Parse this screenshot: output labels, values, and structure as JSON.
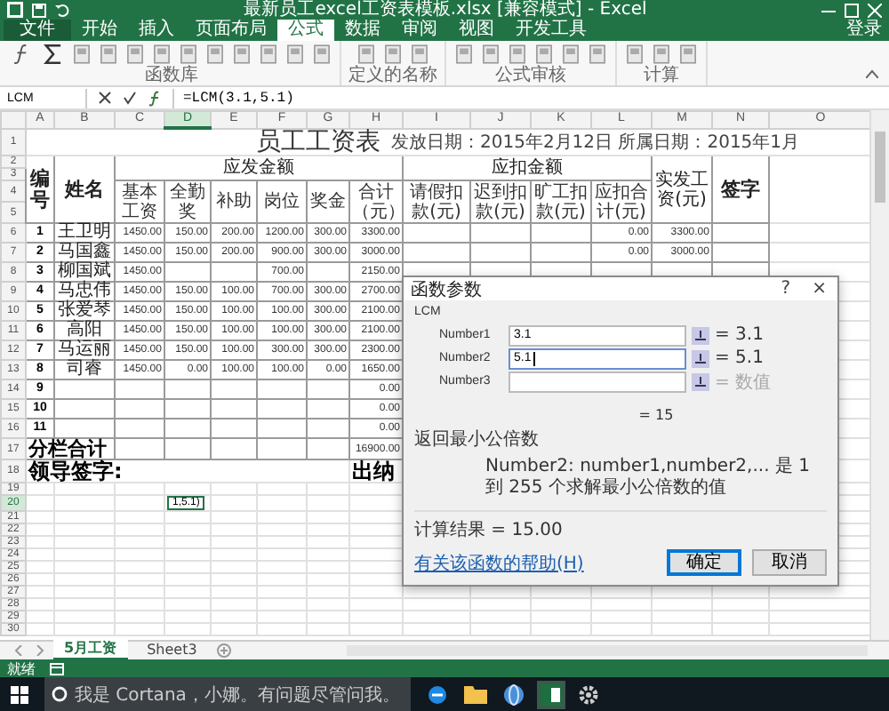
{
  "window": {
    "title": "最新员工excel工资表模板.xlsx [兼容模式] - Excel"
  },
  "ribbon_tabs": [
    {
      "label": "文件",
      "kind": "file",
      "selected": false
    },
    {
      "label": "开始",
      "kind": "tab",
      "selected": false
    },
    {
      "label": "插入",
      "kind": "tab",
      "selected": false
    },
    {
      "label": "页面布局",
      "kind": "tab",
      "selected": false
    },
    {
      "label": "公式",
      "kind": "tab",
      "selected": true
    },
    {
      "label": "数据",
      "kind": "tab",
      "selected": false
    },
    {
      "label": "审阅",
      "kind": "tab",
      "selected": false
    },
    {
      "label": "视图",
      "kind": "tab",
      "selected": false
    },
    {
      "label": "开发工具",
      "kind": "tab",
      "selected": false
    }
  ],
  "sign_in": "登录",
  "ribbon_groups": [
    {
      "label": "函数库"
    },
    {
      "label": "定义的名称"
    },
    {
      "label": "公式审核"
    },
    {
      "label": "计算"
    }
  ],
  "formula_bar": {
    "name_box": "LCM",
    "formula": "=LCM(3.1,5.1)"
  },
  "sheet": {
    "columns": [
      {
        "label": "A",
        "selected": false
      },
      {
        "label": "B",
        "selected": false
      },
      {
        "label": "C",
        "selected": false
      },
      {
        "label": "D",
        "selected": true
      },
      {
        "label": "E",
        "selected": false
      },
      {
        "label": "F",
        "selected": false
      },
      {
        "label": "G",
        "selected": false
      },
      {
        "label": "H",
        "selected": false
      },
      {
        "label": "I",
        "selected": false
      },
      {
        "label": "J",
        "selected": false
      },
      {
        "label": "K",
        "selected": false
      },
      {
        "label": "L",
        "selected": false
      },
      {
        "label": "M",
        "selected": false
      },
      {
        "label": "N",
        "selected": false
      },
      {
        "label": "O",
        "selected": false
      }
    ],
    "row_numbers": [
      {
        "label": "1",
        "selected": false
      },
      {
        "label": "2",
        "selected": false
      },
      {
        "label": "3",
        "selected": false
      },
      {
        "label": "4",
        "selected": false
      },
      {
        "label": "5",
        "selected": false
      },
      {
        "label": "6",
        "selected": false
      },
      {
        "label": "7",
        "selected": false
      },
      {
        "label": "8",
        "selected": false
      },
      {
        "label": "9",
        "selected": false
      },
      {
        "label": "10",
        "selected": false
      },
      {
        "label": "11",
        "selected": false
      },
      {
        "label": "12",
        "selected": false
      },
      {
        "label": "13",
        "selected": false
      },
      {
        "label": "14",
        "selected": false
      },
      {
        "label": "15",
        "selected": false
      },
      {
        "label": "16",
        "selected": false
      },
      {
        "label": "17",
        "selected": false
      },
      {
        "label": "18",
        "selected": false
      },
      {
        "label": "19",
        "selected": false
      },
      {
        "label": "20",
        "selected": true
      },
      {
        "label": "21",
        "selected": false
      },
      {
        "label": "22",
        "selected": false
      },
      {
        "label": "23",
        "selected": false
      },
      {
        "label": "24",
        "selected": false
      },
      {
        "label": "25",
        "selected": false
      },
      {
        "label": "26",
        "selected": false
      },
      {
        "label": "27",
        "selected": false
      },
      {
        "label": "28",
        "selected": false
      },
      {
        "label": "29",
        "selected": false
      },
      {
        "label": "30",
        "selected": false
      }
    ],
    "title": "员工工资表",
    "dates": "发放日期：2015年2月12日  所属日期：2015年1月",
    "header": {
      "no": "编号",
      "name": "姓名",
      "pay_group": "应发金额",
      "deduct_group": "应扣金额",
      "net": "实发工资(元)",
      "sign": "签字",
      "pay_cols": [
        "基本工资",
        "全勤奖",
        "补助",
        "岗位",
        "奖金",
        "合计（元）"
      ],
      "deduct_cols": [
        "请假扣款(元)",
        "迟到扣款(元)",
        "旷工扣款(元)",
        "应扣合计(元)"
      ]
    },
    "employees": [
      {
        "no": "1",
        "name": "王卫明",
        "cells": [
          "1450.00",
          "150.00",
          "200.00",
          "1200.00",
          "300.00",
          "3300.00",
          null,
          null,
          null,
          "0.00",
          "3300.00"
        ]
      },
      {
        "no": "2",
        "name": "马国鑫",
        "cells": [
          "1450.00",
          "150.00",
          "200.00",
          "900.00",
          "300.00",
          "3000.00",
          null,
          null,
          null,
          "0.00",
          "3000.00"
        ]
      },
      {
        "no": "3",
        "name": "柳国斌",
        "cells": [
          "1450.00",
          null,
          null,
          "700.00",
          null,
          "2150.00"
        ]
      },
      {
        "no": "4",
        "name": "马忠伟",
        "cells": [
          "1450.00",
          "150.00",
          "100.00",
          "700.00",
          "300.00",
          "2700.00"
        ]
      },
      {
        "no": "5",
        "name": "张爱琴",
        "cells": [
          "1450.00",
          "150.00",
          "100.00",
          "100.00",
          "300.00",
          "2100.00"
        ]
      },
      {
        "no": "6",
        "name": "高阳",
        "cells": [
          "1450.00",
          "150.00",
          "100.00",
          "100.00",
          "300.00",
          "2100.00"
        ]
      },
      {
        "no": "7",
        "name": "马运丽",
        "cells": [
          "1450.00",
          "150.00",
          "100.00",
          "300.00",
          "300.00",
          "2300.00"
        ]
      },
      {
        "no": "8",
        "name": "司睿",
        "cells": [
          "1450.00",
          "0.00",
          "100.00",
          "100.00",
          "0.00",
          "1650.00"
        ]
      },
      {
        "no": "9",
        "cells": [
          null,
          null,
          null,
          null,
          null,
          "0.00"
        ]
      },
      {
        "no": "10",
        "cells": [
          null,
          null,
          null,
          null,
          null,
          "0.00"
        ]
      },
      {
        "no": "11",
        "cells": [
          null,
          null,
          null,
          null,
          null,
          "0.00"
        ]
      }
    ],
    "subtotal": {
      "label": "分栏合计",
      "total": "16900.00"
    },
    "footer": {
      "leader": "领导签字:",
      "cashier": "出纳"
    },
    "edit_cell": "1,5.1)"
  },
  "dialog": {
    "title": "函数参数",
    "help": "?",
    "close": "×",
    "function": "LCM",
    "args": [
      {
        "label": "Number1",
        "value": "3.1",
        "result": "= 3.1",
        "focused": false,
        "muted": false
      },
      {
        "label": "Number2",
        "value": "5.1",
        "result": "= 5.1",
        "focused": true,
        "muted": false
      },
      {
        "label": "Number3",
        "result": "= 数值",
        "focused": false,
        "muted": true
      }
    ],
    "result": "= 15",
    "description": "返回最小公倍数",
    "arg_help": "Number2:  number1,number2,... 是 1 到 255 个求解最小公倍数的值",
    "calc_result": "计算结果 =  15.00",
    "help_link": "有关该函数的帮助(H)",
    "buttons": [
      {
        "label": "确定",
        "selected": true
      },
      {
        "label": "取消",
        "selected": false
      }
    ]
  },
  "sheet_tabs": [
    {
      "label": "5月工资",
      "selected": true
    },
    {
      "label": "Sheet3",
      "selected": false
    }
  ],
  "status_bar": {
    "mode": "就绪"
  },
  "taskbar": {
    "search_placeholder": "我是 Cortana，小娜。有问题尽管问我。"
  }
}
